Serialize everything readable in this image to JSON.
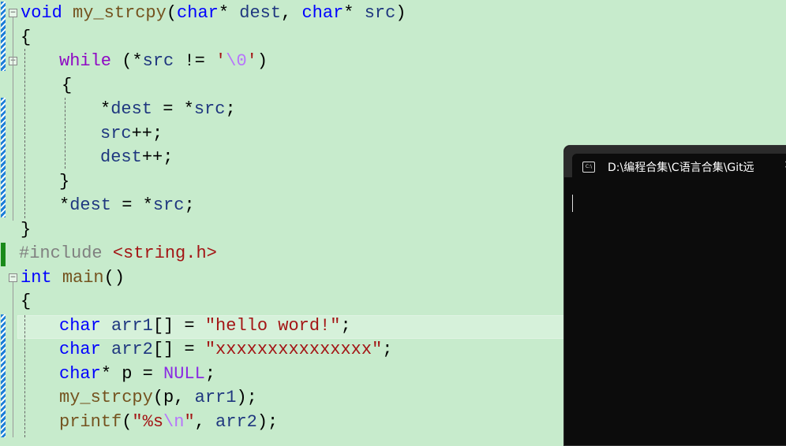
{
  "editor": {
    "lines": [
      {
        "t": [
          [
            "kw",
            "void"
          ],
          [
            "op",
            " "
          ],
          [
            "fn",
            "my_strcpy"
          ],
          [
            "op",
            "("
          ],
          [
            "kw",
            "char"
          ],
          [
            "op",
            "* "
          ],
          [
            "prm",
            "dest"
          ],
          [
            "op",
            ", "
          ],
          [
            "kw",
            "char"
          ],
          [
            "op",
            "* "
          ],
          [
            "prm",
            "src"
          ],
          [
            "op",
            ")"
          ]
        ]
      },
      {
        "t": [
          [
            "op",
            "{"
          ]
        ]
      },
      {
        "t": [
          [
            "ctl",
            "while"
          ],
          [
            "op",
            " (*"
          ],
          [
            "prm",
            "src"
          ],
          [
            "op",
            " != "
          ],
          [
            "str",
            "'"
          ],
          [
            "esc",
            "\\0"
          ],
          [
            "str",
            "'"
          ],
          [
            "op",
            ")"
          ]
        ]
      },
      {
        "t": [
          [
            "op",
            "{"
          ]
        ]
      },
      {
        "t": [
          [
            "op",
            "*"
          ],
          [
            "prm",
            "dest"
          ],
          [
            "op",
            " = *"
          ],
          [
            "prm",
            "src"
          ],
          [
            "op",
            ";"
          ]
        ]
      },
      {
        "t": [
          [
            "prm",
            "src"
          ],
          [
            "op",
            "++;"
          ]
        ]
      },
      {
        "t": [
          [
            "prm",
            "dest"
          ],
          [
            "op",
            "++;"
          ]
        ]
      },
      {
        "t": [
          [
            "op",
            "}"
          ]
        ]
      },
      {
        "t": [
          [
            "op",
            "*"
          ],
          [
            "prm",
            "dest"
          ],
          [
            "op",
            " = *"
          ],
          [
            "prm",
            "src"
          ],
          [
            "op",
            ";"
          ]
        ]
      },
      {
        "t": [
          [
            "op",
            "}"
          ]
        ]
      },
      {
        "t": [
          [
            "pp",
            "#include "
          ],
          [
            "str",
            "<string.h>"
          ]
        ]
      },
      {
        "t": [
          [
            "kw",
            "int"
          ],
          [
            "op",
            " "
          ],
          [
            "fn",
            "main"
          ],
          [
            "op",
            "()"
          ]
        ]
      },
      {
        "t": [
          [
            "op",
            "{"
          ]
        ]
      },
      {
        "t": [
          [
            "kw",
            "char"
          ],
          [
            "op",
            " "
          ],
          [
            "prm",
            "arr1"
          ],
          [
            "op",
            "[] = "
          ],
          [
            "str",
            "\"hello word!\""
          ],
          [
            "op",
            ";"
          ]
        ]
      },
      {
        "t": [
          [
            "kw",
            "char"
          ],
          [
            "op",
            " "
          ],
          [
            "prm",
            "arr2"
          ],
          [
            "op",
            "[] = "
          ],
          [
            "str",
            "\"xxxxxxxxxxxxxxx\""
          ],
          [
            "op",
            ";"
          ]
        ]
      },
      {
        "t": [
          [
            "kw",
            "char"
          ],
          [
            "op",
            "* "
          ],
          [
            "op",
            "p"
          ],
          [
            "op",
            " = "
          ],
          [
            "mac",
            "NULL"
          ],
          [
            "op",
            ";"
          ]
        ]
      },
      {
        "t": [
          [
            "fn",
            "my_strcpy"
          ],
          [
            "op",
            "("
          ],
          [
            "op",
            "p"
          ],
          [
            "op",
            ", "
          ],
          [
            "prm",
            "arr1"
          ],
          [
            "op",
            ");"
          ]
        ]
      },
      {
        "t": [
          [
            "fn",
            "printf"
          ],
          [
            "op",
            "("
          ],
          [
            "str",
            "\"%s"
          ],
          [
            "esc",
            "\\n"
          ],
          [
            "str",
            "\""
          ],
          [
            "op",
            ", "
          ],
          [
            "prm",
            "arr2"
          ],
          [
            "op",
            ");"
          ]
        ]
      }
    ]
  },
  "terminal": {
    "icon": "console-icon",
    "icon_text": "C:\\",
    "title": "D:\\编程合集\\C语言合集\\Git远",
    "close": "×"
  },
  "colors": {
    "background": "#c7ebcc",
    "keyword": "#0000ff",
    "string": "#a31515",
    "terminal_bg": "#0c0c0c"
  }
}
